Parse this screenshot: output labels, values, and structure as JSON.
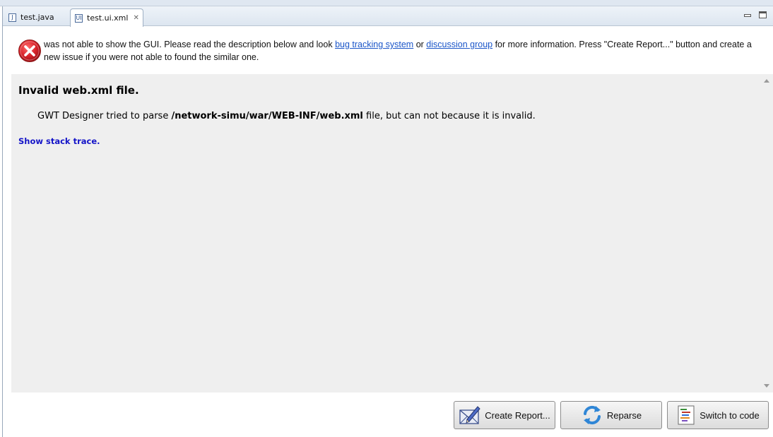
{
  "tabs": [
    {
      "label": "test.java",
      "icon": "java-file-icon",
      "icon_glyph": "J"
    },
    {
      "label": "test.ui.xml",
      "icon": "ui-xml-file-icon",
      "icon_glyph": "UI",
      "close_glyph": "✕"
    }
  ],
  "message": {
    "icon": "error-icon",
    "text_before_link1": " was not able to show the GUI. Please read the description below and look ",
    "link1": "bug tracking system",
    "text_between": " or ",
    "link2": "discussion group",
    "text_after": " for more information. Press \"Create Report...\" button and create a new issue if you were not able to found the similar one."
  },
  "panel": {
    "title": "Invalid web.xml file.",
    "desc_before": "GWT Designer tried to parse ",
    "desc_path": "/network-simu/war/WEB-INF/web.xml",
    "desc_after": " file, but can not because it is invalid.",
    "link": "Show stack trace."
  },
  "buttons": {
    "create_report": "Create Report...",
    "reparse": "Reparse",
    "switch_to_code": "Switch to code"
  },
  "colors": {
    "link": "#1a55c8",
    "panel_link": "#1414c8",
    "error_red": "#d8232a",
    "panel_bg": "#efefef"
  }
}
